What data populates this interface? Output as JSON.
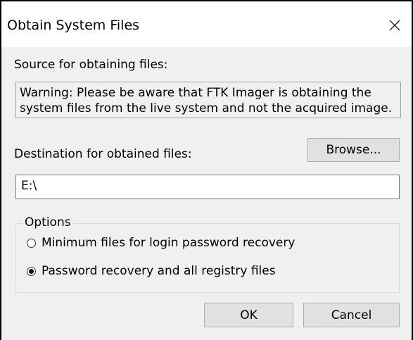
{
  "dialog": {
    "title": "Obtain System Files"
  },
  "source": {
    "label": "Source for obtaining files:",
    "warning": "Warning:  Please be aware that FTK Imager is obtaining the system files from the live system and not the acquired image."
  },
  "destination": {
    "label": "Destination for obtained files:",
    "browse_label": "Browse...",
    "value": "E:\\"
  },
  "options": {
    "legend": "Options",
    "items": [
      {
        "label": "Minimum files for login password recovery",
        "checked": false
      },
      {
        "label": "Password recovery and all registry files",
        "checked": true
      }
    ]
  },
  "buttons": {
    "ok": "OK",
    "cancel": "Cancel"
  }
}
